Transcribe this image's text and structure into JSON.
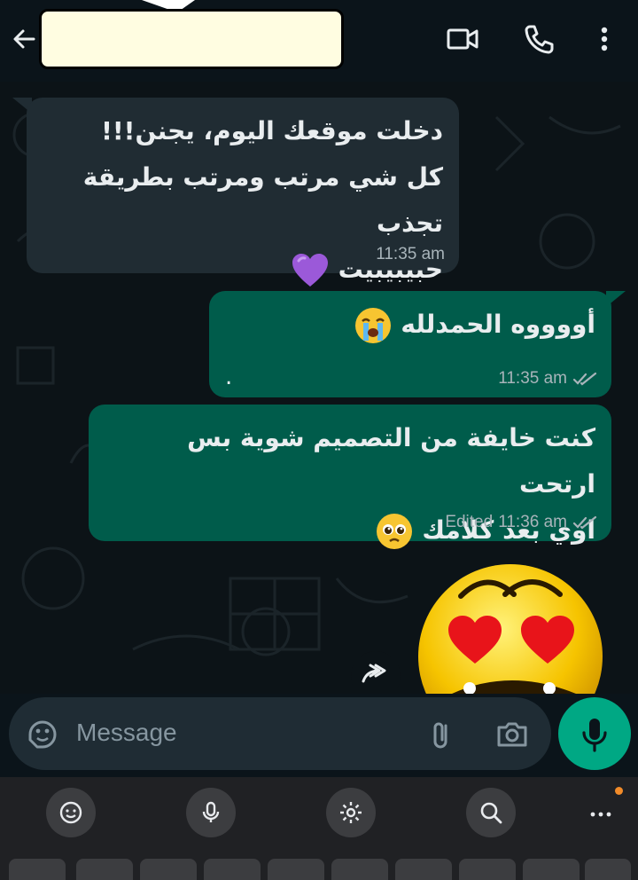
{
  "header": {
    "contact_name_redacted": true,
    "icons": [
      "back-arrow-icon",
      "video-call-icon",
      "phone-call-icon",
      "more-vertical-icon"
    ]
  },
  "messages": [
    {
      "direction": "incoming",
      "lines": [
        "دخلت موقعك اليوم، يجنن!!!",
        "كل شي مرتب ومرتب بطريقة تجذب",
        "حبيبيبيت"
      ],
      "emoji": "purple-heart",
      "time": "11:35 am"
    },
    {
      "direction": "outgoing",
      "lines": [
        "أووووه الحمدلله",
        "."
      ],
      "emoji": "loudly-crying-face",
      "time": "11:35 am",
      "status": "read"
    },
    {
      "direction": "outgoing",
      "lines": [
        "كنت خايفة من التصميم شوية بس ارتحت",
        "اوي بعد كلامك"
      ],
      "emoji": "pleading-face",
      "edited_label": "Edited",
      "time": "11:36 am",
      "status": "read"
    },
    {
      "direction": "outgoing",
      "type": "sticker",
      "sticker": "heart-eyes-emoji"
    }
  ],
  "input": {
    "placeholder": "Message",
    "icons": [
      "sticker-icon",
      "attach-icon",
      "camera-icon",
      "mic-icon"
    ]
  },
  "keyboard": {
    "toolbar": [
      "emoji-icon",
      "mic-icon",
      "settings-icon",
      "search-icon",
      "more-horizontal-icon"
    ],
    "more_label": "...",
    "notification_dot_color": "#f28b29"
  },
  "colors": {
    "incoming_bubble": "#202c33",
    "outgoing_bubble": "#005c4b",
    "accent_green": "#00a884",
    "background": "#0b141a"
  }
}
